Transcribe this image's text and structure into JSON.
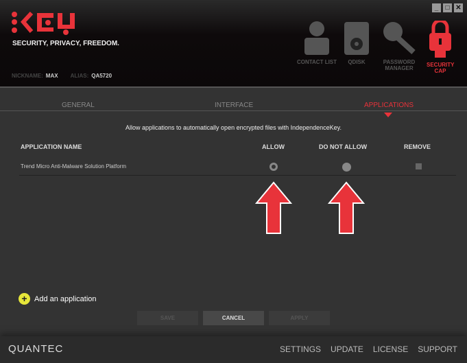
{
  "header": {
    "tagline": "SECURITY, PRIVACY, FREEDOM.",
    "nickname_label": "NICKNAME:",
    "nickname": "MAX",
    "alias_label": "ALIAS:",
    "alias": "QA5720",
    "logo_text": "KEY"
  },
  "window": {
    "minimize": "_",
    "maximize": "□",
    "close": "✕"
  },
  "nav": [
    {
      "label": "CONTACT LIST"
    },
    {
      "label": "QDISK"
    },
    {
      "label": "PASSWORD MANAGER"
    },
    {
      "label": "SECURITY CAP"
    }
  ],
  "tabs": [
    {
      "label": "GENERAL"
    },
    {
      "label": "INTERFACE"
    },
    {
      "label": "APPLICATIONS"
    }
  ],
  "description": "Allow applications to automatically open  encrypted files with IndependenceKey.",
  "table": {
    "headers": [
      "APPLICATION NAME",
      "ALLOW",
      "DO NOT ALLOW",
      "REMOVE"
    ],
    "rows": [
      {
        "name": "Trend Micro Anti-Malware Solution Platform",
        "selected": "allow"
      }
    ]
  },
  "add_label": "Add an application",
  "buttons": {
    "save": "SAVE",
    "cancel": "CANCEL",
    "apply": "APPLY"
  },
  "footer": {
    "brand": "QUANTEC",
    "links": [
      "SETTINGS",
      "UPDATE",
      "LICENSE",
      "SUPPORT"
    ]
  },
  "colors": {
    "accent": "#e8333a",
    "add": "#e6e63a"
  }
}
